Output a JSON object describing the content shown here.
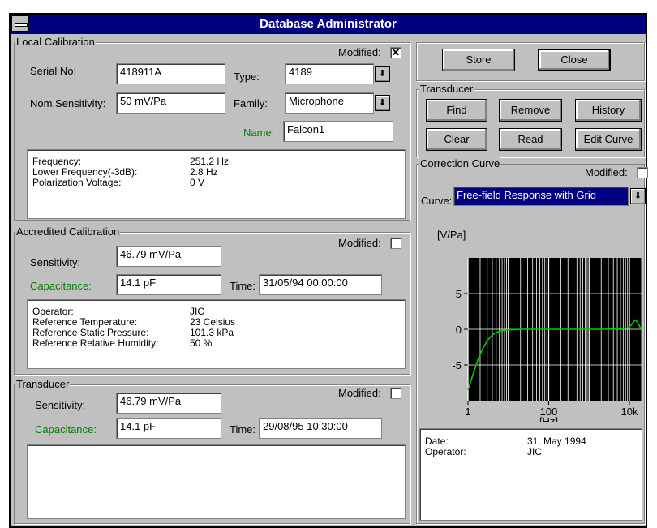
{
  "window": {
    "title": "Database Administrator"
  },
  "local_calibration": {
    "legend": "Local Calibration",
    "modified_label": "Modified:",
    "modified_mark": "✕",
    "serial_label": "Serial No:",
    "serial_value": "418911A",
    "type_label": "Type:",
    "type_value": "4189",
    "nom_sens_label": "Nom.Sensitivity:",
    "nom_sens_value": "50 mV/Pa",
    "family_label": "Family:",
    "family_value": "Microphone",
    "name_label": "Name:",
    "name_value": "Falcon1",
    "info": [
      {
        "key": "Frequency:",
        "value": "251.2 Hz"
      },
      {
        "key": "Lower Frequency(-3dB):",
        "value": "2.8 Hz"
      },
      {
        "key": "Polarization Voltage:",
        "value": "0 V"
      }
    ]
  },
  "accredited_calibration": {
    "legend": "Accredited Calibration",
    "modified_label": "Modified:",
    "sensitivity_label": "Sensitivity:",
    "sensitivity_value": "46.79 mV/Pa",
    "capacitance_label": "Capacitance:",
    "capacitance_value": "14.1 pF",
    "time_label": "Time:",
    "time_value": "31/05/94 00:00:00",
    "info": [
      {
        "key": "Operator:",
        "value": "JIC"
      },
      {
        "key": "Reference Temperature:",
        "value": "23 Celsius"
      },
      {
        "key": "Reference Static Pressure:",
        "value": "101.3 kPa"
      },
      {
        "key": "Reference Relative Humidity:",
        "value": "50 %"
      }
    ]
  },
  "transducer_left": {
    "legend": "Transducer",
    "modified_label": "Modified:",
    "sensitivity_label": "Sensitivity:",
    "sensitivity_value": "46.79 mV/Pa",
    "capacitance_label": "Capacitance:",
    "capacitance_value": "14.1 pF",
    "time_label": "Time:",
    "time_value": "29/08/95 10:30:00"
  },
  "actions": {
    "store": "Store",
    "close": "Close"
  },
  "transducer_right": {
    "legend": "Transducer",
    "find": "Find",
    "remove": "Remove",
    "history": "History",
    "clear": "Clear",
    "read": "Read",
    "edit_curve": "Edit Curve"
  },
  "correction_curve": {
    "legend": "Correction Curve",
    "modified_label": "Modified:",
    "curve_label": "Curve:",
    "curve_value": "Free-field Response with Grid",
    "info": [
      {
        "key": "Date:",
        "value": "31. May 1994"
      },
      {
        "key": "Operator:",
        "value": "JIC"
      }
    ]
  },
  "chart_data": {
    "type": "line",
    "ylabel": "[V/Pa]",
    "xlabel": "[Hz]",
    "x_scale": "log",
    "xlim": [
      1,
      20000
    ],
    "ylim": [
      -10,
      10
    ],
    "x_ticks": [
      {
        "value": 1,
        "label": "1"
      },
      {
        "value": 100,
        "label": "100"
      },
      {
        "value": 10000,
        "label": "10k"
      }
    ],
    "y_ticks": [
      {
        "value": 5,
        "label": "5"
      },
      {
        "value": 0,
        "label": "0"
      },
      {
        "value": -5,
        "label": "-5"
      }
    ],
    "grid": true,
    "background": "#000000",
    "line_color": "#00cc00",
    "series": [
      {
        "x": [
          1,
          1.3,
          1.7,
          2.2,
          3,
          4,
          5,
          7,
          10,
          15,
          20,
          30,
          50,
          100,
          200,
          500,
          1000,
          2000,
          5000,
          8000,
          10000,
          12000,
          14000,
          16000,
          20000
        ],
        "y": [
          -8.5,
          -6.5,
          -4.5,
          -3.0,
          -1.6,
          -0.8,
          -0.45,
          -0.2,
          -0.08,
          -0.03,
          0,
          0,
          0,
          0,
          0,
          0,
          0,
          0,
          0.05,
          0.1,
          0.3,
          0.9,
          1.3,
          1.0,
          -0.2
        ]
      }
    ]
  }
}
